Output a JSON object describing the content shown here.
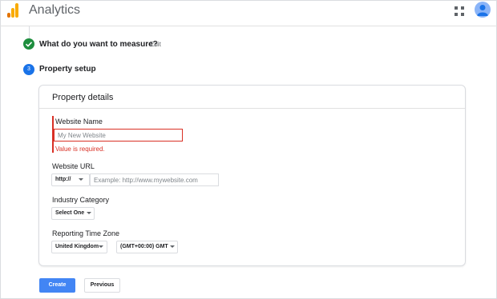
{
  "header": {
    "app_title": "Analytics",
    "logo_icon": "analytics-logo-icon",
    "apps_icon": "apps-grid-icon",
    "avatar_icon": "user-avatar-icon",
    "colors": {
      "logo_orange": "#f9ab00",
      "logo_dark": "#e37400",
      "accent": "#1a73e8"
    }
  },
  "steps": [
    {
      "title": "What do you want to measure?",
      "edit_label": "Edit",
      "status": "complete",
      "icon": "check-icon"
    },
    {
      "number": "3",
      "title": "Property setup",
      "status": "active"
    }
  ],
  "card": {
    "title": "Property details",
    "website_name": {
      "label": "Website Name",
      "placeholder": "My New Website",
      "error": "Value is required."
    },
    "website_url": {
      "label": "Website URL",
      "protocol": "http://",
      "placeholder": "Example: http://www.mywebsite.com"
    },
    "industry": {
      "label": "Industry Category",
      "selected": "Select One"
    },
    "timezone": {
      "label": "Reporting Time Zone",
      "country": "United Kingdom",
      "zone": "(GMT+00:00) GMT"
    }
  },
  "actions": {
    "create_label": "Create",
    "previous_label": "Previous"
  }
}
